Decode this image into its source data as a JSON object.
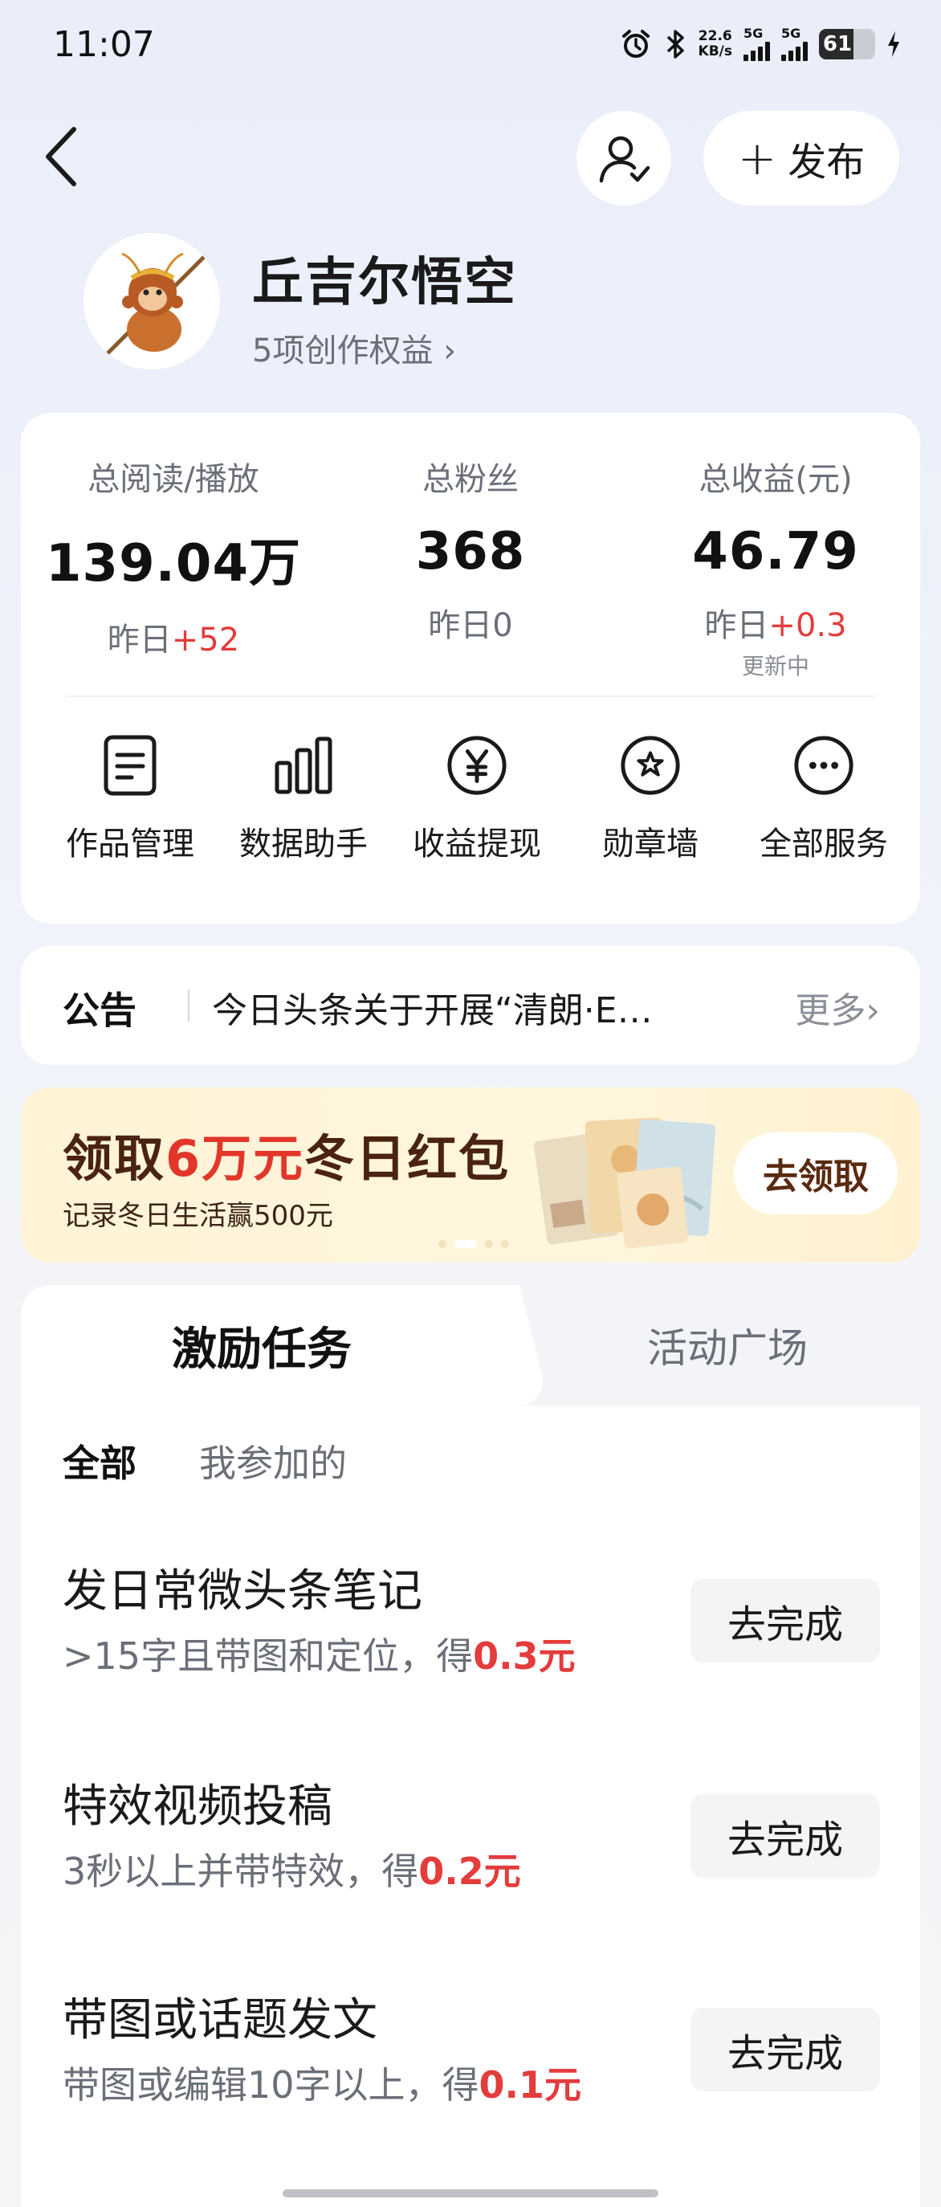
{
  "status_bar": {
    "time": "11:07",
    "net_speed_value": "22.6",
    "net_speed_unit": "KB/s",
    "sim1_label": "5G",
    "sim2_label": "5G",
    "battery_level": "61",
    "icons": [
      "alarm-icon",
      "bluetooth-icon",
      "charging-icon"
    ]
  },
  "header": {
    "publish_label": "发布"
  },
  "profile": {
    "name": "丘吉尔悟空",
    "benefits": "5项创作权益 ›"
  },
  "stats": {
    "reads": {
      "label": "总阅读/播放",
      "value": "139.04万",
      "yday_prefix": "昨日",
      "yday_value": "+52"
    },
    "fans": {
      "label": "总粉丝",
      "value": "368",
      "yday_prefix": "昨日",
      "yday_value": "0"
    },
    "income": {
      "label": "总收益(元)",
      "value": "46.79",
      "yday_prefix": "昨日",
      "yday_value": "+0.3",
      "updating": "更新中"
    }
  },
  "tools": [
    {
      "label": "作品管理",
      "icon": "document-icon"
    },
    {
      "label": "数据助手",
      "icon": "bar-chart-icon"
    },
    {
      "label": "收益提现",
      "icon": "yen-icon"
    },
    {
      "label": "勋章墙",
      "icon": "medal-icon"
    },
    {
      "label": "全部服务",
      "icon": "more-icon"
    }
  ],
  "notice": {
    "title": "公告",
    "text": "今日头条关于开展“清朗·E…",
    "more": "更多›"
  },
  "banner": {
    "title_pre": "领取",
    "title_highlight": "6万元",
    "title_post": "冬日红包",
    "subtitle": "记录冬日生活赢500元",
    "button": "去领取"
  },
  "tasks": {
    "tab_active": "激励任务",
    "tab_inactive": "活动广场",
    "filter_all": "全部",
    "filter_mine": "我参加的",
    "items": [
      {
        "title": "发日常微头条笔记",
        "desc": ">15字且带图和定位，得",
        "reward": "0.3元",
        "button": "去完成"
      },
      {
        "title": "特效视频投稿",
        "desc": "3秒以上并带特效，得",
        "reward": "0.2元",
        "button": "去完成"
      },
      {
        "title": "带图或话题发文",
        "desc": "带图或编辑10字以上，得",
        "reward": "0.1元",
        "button": "去完成"
      }
    ]
  },
  "colors": {
    "accent_red": "#e33c3c",
    "banner_text": "#4a2411"
  }
}
